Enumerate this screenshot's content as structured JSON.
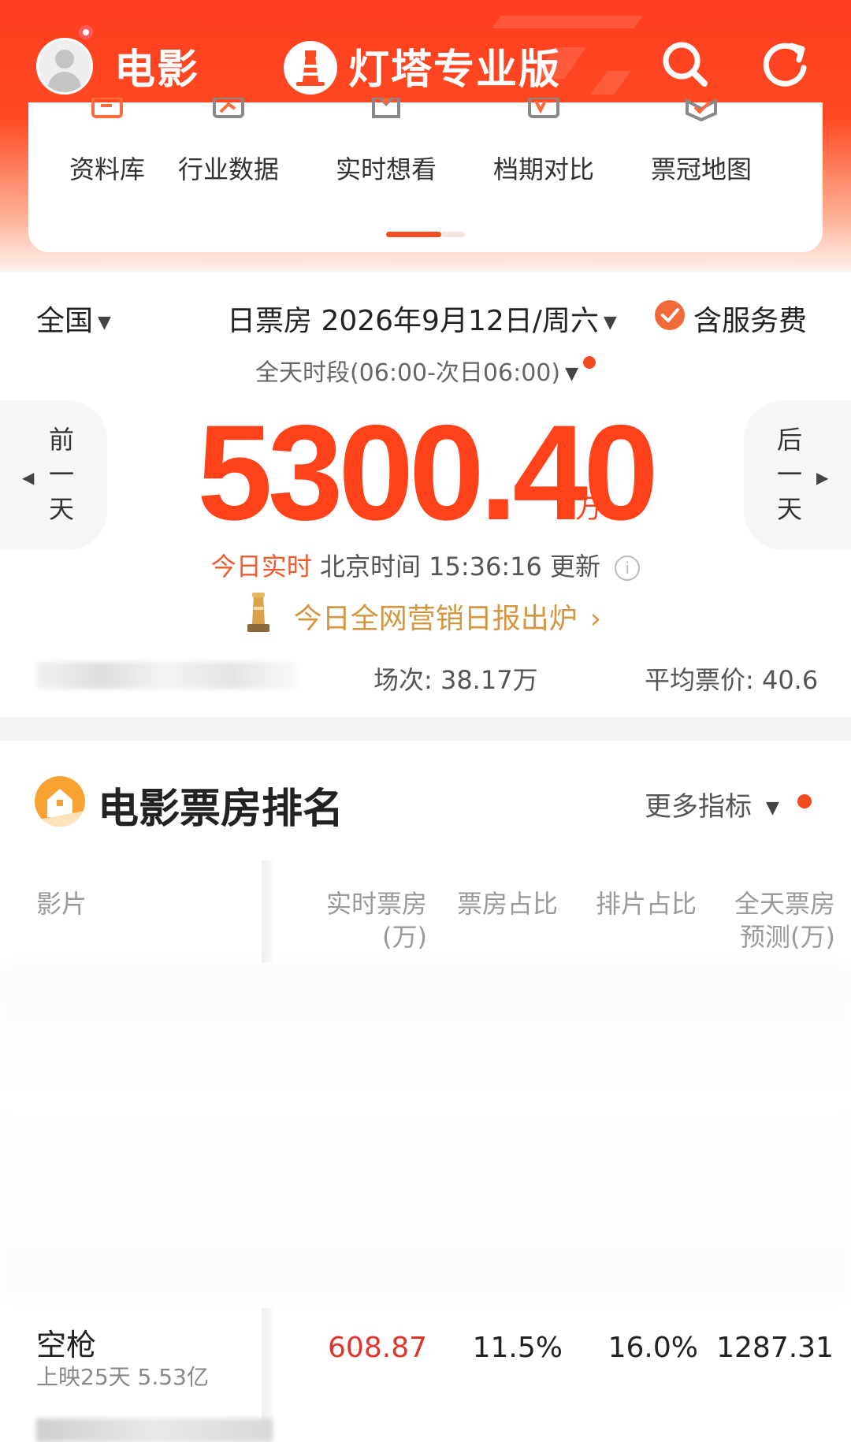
{
  "header": {
    "section_title": "电影",
    "brand_title": "灯塔专业版",
    "colors": {
      "brand": "#ff3d1f",
      "accent": "#ff4219",
      "gold": "#d49740"
    }
  },
  "quick_nav": {
    "items": [
      {
        "label": "资料库",
        "icon": "library-icon"
      },
      {
        "label": "行业数据",
        "icon": "trend-chart-icon"
      },
      {
        "label": "实时想看",
        "icon": "realtime-want-icon"
      },
      {
        "label": "档期对比",
        "icon": "versus-icon"
      },
      {
        "label": "票冠地图",
        "icon": "map-icon"
      }
    ],
    "current_page": 1,
    "page_count": 2
  },
  "summary": {
    "region": "全国",
    "date_filter": "日票房 2026年9月12日/周六",
    "service_fee_label": "含服务费",
    "service_fee_checked": true,
    "period": "全天时段(06:00-次日06:00)",
    "prev_day": [
      "前",
      "一",
      "天"
    ],
    "next_day": [
      "后",
      "一",
      "天"
    ],
    "total": "5300.40",
    "unit": "万",
    "update_prefix": "今日实时",
    "update_text": "北京时间 15:36:16 更新",
    "report_text": "今日全网营销日报出炉",
    "report_chevron": "›",
    "screenings": "场次: 38.17万",
    "avg_price": "平均票价: 40.6"
  },
  "ranking": {
    "title": "电影票房排名",
    "more_metrics": "更多指标",
    "columns": {
      "film": "影片",
      "realtime": [
        "实时票房",
        "(万)"
      ],
      "share": "票房占比",
      "schedule": "排片占比",
      "forecast": [
        "全天票房",
        "预测(万)"
      ]
    },
    "rows": [
      {
        "title": "空枪",
        "subtitle": "上映25天 5.53亿",
        "realtime": "608.87",
        "share": "11.5%",
        "schedule": "16.0%",
        "forecast": "1287.31"
      }
    ]
  }
}
